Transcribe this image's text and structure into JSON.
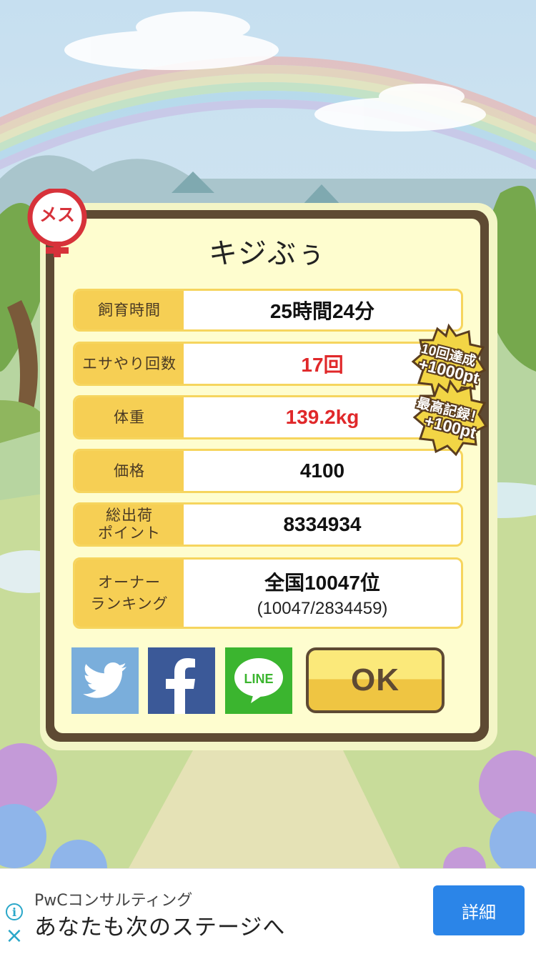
{
  "pet": {
    "name": "キジぶぅ",
    "gender_label": "メス"
  },
  "stats": [
    {
      "label": "飼育時間",
      "value": "25時間24分",
      "sub": ""
    },
    {
      "label": "エサやり回数",
      "value": "17回",
      "sub": ""
    },
    {
      "label": "体重",
      "value": "139.2kg",
      "sub": ""
    },
    {
      "label": "価格",
      "value": "4100",
      "sub": ""
    },
    {
      "label_lines": [
        "総出荷",
        "ポイント"
      ],
      "value": "8334934",
      "sub": ""
    },
    {
      "label_lines": [
        "オーナー",
        "ランキング"
      ],
      "value": "全国10047位",
      "sub": "(10047/2834459)"
    }
  ],
  "badges": [
    {
      "line1": "10回達成",
      "line2": "+1000pt"
    },
    {
      "line1": "最高記録！",
      "line2": "+100pt"
    }
  ],
  "share": {
    "twitter_icon": "twitter-bird-icon",
    "facebook_icon": "facebook-f-icon",
    "line_label": "LINE"
  },
  "ok_label": "OK",
  "ad": {
    "source": "PwCコンサルティング",
    "title": "あなたも次のステージへ",
    "button": "詳細",
    "info_icon": "i",
    "close_icon": "×"
  },
  "colors": {
    "accent_yellow": "#f6cf54",
    "highlight_red": "#e0282a",
    "frame_brown": "#5e4a33",
    "twitter_blue": "#7aaedb",
    "facebook_blue": "#3b5998",
    "line_green": "#3bb52f",
    "ad_button_blue": "#2b85e8"
  }
}
